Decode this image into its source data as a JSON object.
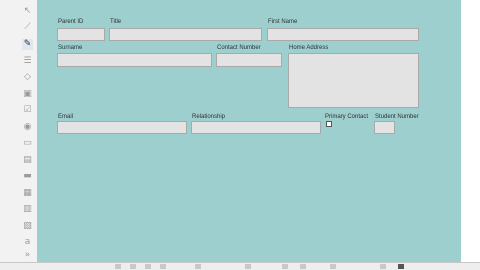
{
  "form": {
    "parent_id_label": "Parent ID",
    "title_label": "Title",
    "first_name_label": "First Name",
    "surname_label": "Surname",
    "contact_number_label": "Contact Number",
    "home_address_label": "Home Address",
    "email_label": "Email",
    "relationship_label": "Relationship",
    "primary_contact_label": "Primary Contact",
    "student_number_label": "Student Number"
  },
  "toolbox": {
    "tools": [
      "pointer-icon",
      "line-icon",
      "wand-icon",
      "list-icon",
      "tag-icon",
      "image-icon",
      "checkbox-icon",
      "radio-icon",
      "textbox-icon",
      "combobox-icon",
      "button-icon",
      "date-icon",
      "table-icon",
      "subform-icon",
      "text-icon",
      "tab-icon",
      "expand-icon"
    ]
  },
  "colors": {
    "canvas_bg": "#9dcfcf",
    "field_bg": "#e3e3e3",
    "field_border": "#a9a9a9"
  }
}
